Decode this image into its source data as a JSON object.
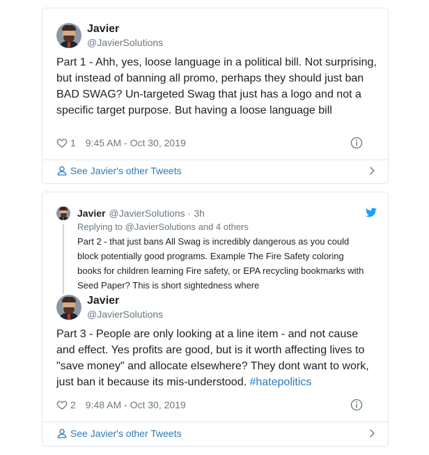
{
  "tweet1": {
    "author": {
      "name": "Javier",
      "handle": "@JavierSolutions"
    },
    "text": "Part 1 - Ahh, yes, loose language in a political bill. Not surprising, but instead of banning all promo, perhaps they should just ban BAD SWAG? Un-targeted Swag that just has a logo and not a specific target purpose. But having a loose language bill",
    "likes": "1",
    "timestamp": "9:45 AM - Oct 30, 2019",
    "more_link": "See Javier's other Tweets"
  },
  "tweet2": {
    "parent": {
      "name": "Javier",
      "handle": "@JavierSolutions",
      "separator": "·",
      "time": "3h",
      "replying_to": "Replying to @JavierSolutions and 4 others",
      "text": "Part 2 - that just bans All Swag is incredibly dangerous as you could block potentially good programs. Example The Fire Safety coloring books for children learning Fire safety, or EPA recycling bookmarks with Seed Paper? This is short sightedness where"
    },
    "author": {
      "name": "Javier",
      "handle": "@JavierSolutions"
    },
    "text": "Part 3 - People are only looking at a line item - and not cause and effect. Yes profits are good, but is it worth affecting lives to \"save money\" and allocate elsewhere? They dont want to work, just ban it because its mis-understood.",
    "hashtag": "#hatepolitics",
    "likes": "2",
    "timestamp": "9:48 AM - Oct 30, 2019",
    "more_link": "See Javier's other Tweets"
  },
  "colors": {
    "link": "#2b7bb9",
    "muted": "#697882",
    "border": "#e1e8ed",
    "twitter_blue": "#1da1f2"
  },
  "icons": [
    "heart-icon",
    "info-icon",
    "person-icon",
    "chevron-right-icon",
    "twitter-bird-icon"
  ]
}
